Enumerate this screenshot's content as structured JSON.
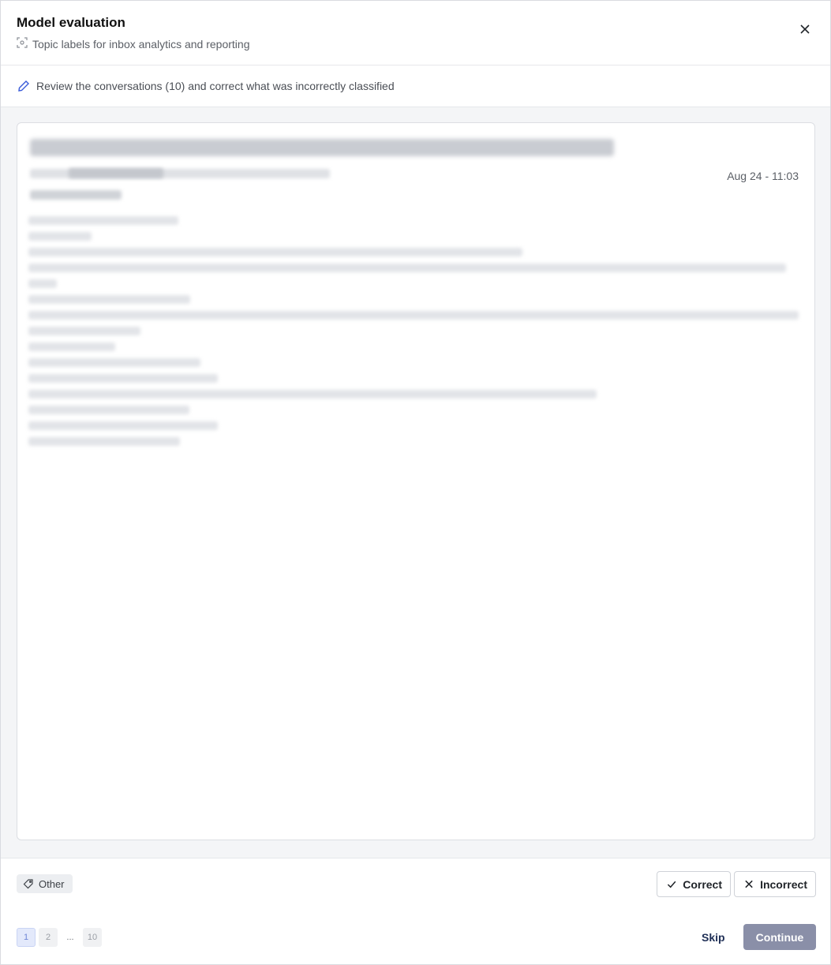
{
  "header": {
    "title": "Model evaluation",
    "subtitle": "Topic labels for inbox analytics and reporting"
  },
  "instruction": {
    "text": "Review the conversations (10) and correct what was incorrectly classified"
  },
  "conversation": {
    "date": "Aug 24 - 11:03"
  },
  "classification": {
    "label": "Other"
  },
  "actions": {
    "correct_label": "Correct",
    "incorrect_label": "Incorrect"
  },
  "pagination": {
    "pages": [
      "1",
      "2",
      "...",
      "10"
    ]
  },
  "footer": {
    "skip_label": "Skip",
    "continue_label": "Continue"
  },
  "colors": {
    "accent": "#1f2f56",
    "continue_bg": "#8a8fa8",
    "page_active_bg": "#e3e9fb",
    "pencil": "#3a5bd9"
  }
}
